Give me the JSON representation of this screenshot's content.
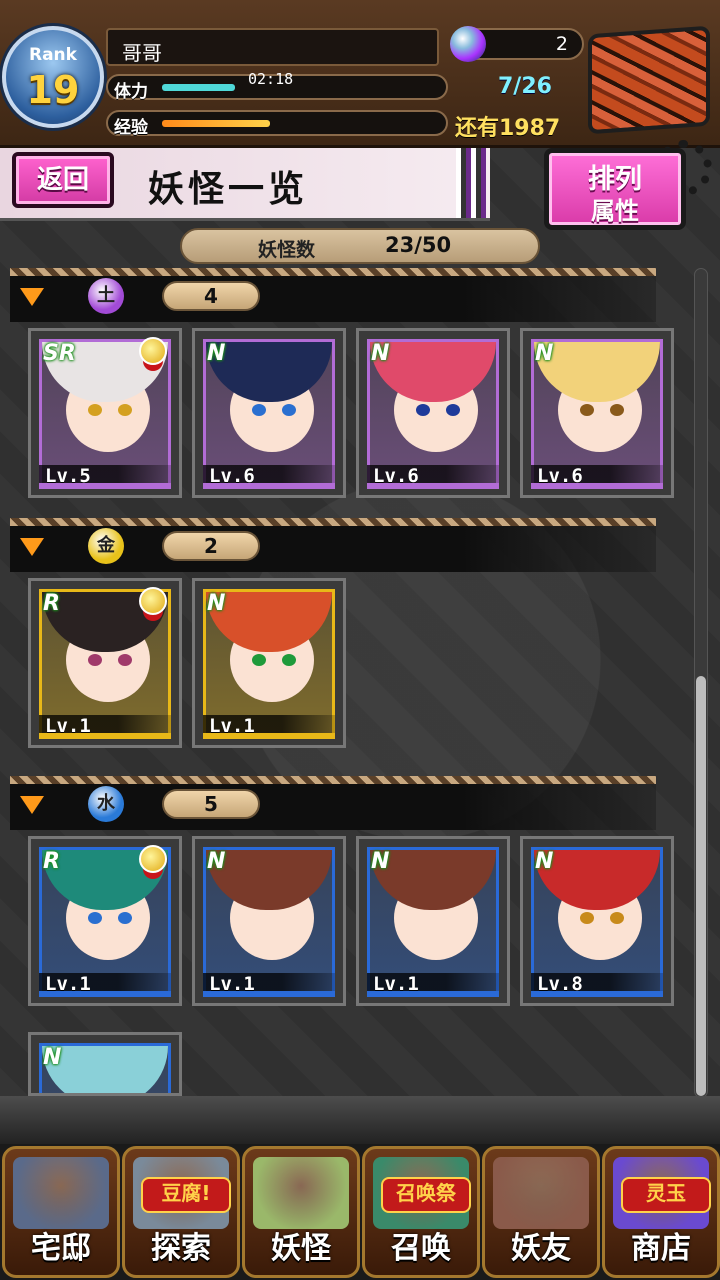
{
  "player": {
    "rank_label": "Rank",
    "rank": "19",
    "name": "哥哥",
    "stamina_label": "体力",
    "stamina_timer": "02:18",
    "stamina_value": "7/26",
    "stamina_fraction": 0.27,
    "exp_label": "经验",
    "exp_fraction": 0.4,
    "exp_remaining": "还有1987",
    "gems": "2"
  },
  "page": {
    "back_label": "返回",
    "title": "妖怪一览",
    "sort_line1": "排列",
    "sort_line2": "属性",
    "count_label": "妖怪数",
    "count_value": "23/50"
  },
  "groups": [
    {
      "attribute_icon": "dark-attribute-icon",
      "attribute_glyph": "土",
      "attribute_color": "#a24bd6",
      "count": "4",
      "cards": [
        {
          "rarity": "SR",
          "level": "Lv.5",
          "medal": true,
          "hair": "#e8e4e4",
          "eye": "#d4a020",
          "frame": "#b26cd6"
        },
        {
          "rarity": "N",
          "level": "Lv.6",
          "medal": false,
          "hair": "#1e2a56",
          "eye": "#2a6fd0",
          "frame": "#b26cd6"
        },
        {
          "rarity": "N",
          "level": "Lv.6",
          "medal": false,
          "hair": "#e04a6a",
          "eye": "#1e3a9a",
          "frame": "#b26cd6"
        },
        {
          "rarity": "N",
          "level": "Lv.6",
          "medal": false,
          "hair": "#f2d27a",
          "eye": "#8a5a1a",
          "frame": "#b26cd6"
        }
      ]
    },
    {
      "attribute_icon": "light-attribute-icon",
      "attribute_glyph": "金",
      "attribute_color": "#e8c21a",
      "count": "2",
      "cards": [
        {
          "rarity": "R",
          "level": "Lv.1",
          "medal": true,
          "hair": "#2a2222",
          "eye": "#a03a6a",
          "frame": "#e8b818"
        },
        {
          "rarity": "N",
          "level": "Lv.1",
          "medal": false,
          "hair": "#d8502a",
          "eye": "#1e9a3a",
          "frame": "#e8b818"
        }
      ]
    },
    {
      "attribute_icon": "water-attribute-icon",
      "attribute_glyph": "水",
      "attribute_color": "#2a7ad8",
      "count": "5",
      "cards": [
        {
          "rarity": "R",
          "level": "Lv.1",
          "medal": true,
          "hair": "#1e8a7a",
          "eye": "#2a6fd0",
          "frame": "#2a6ad8"
        },
        {
          "rarity": "N",
          "level": "Lv.1",
          "medal": false,
          "hair": "#7a3a2a",
          "eye": "#fbe2d3",
          "frame": "#2a6ad8"
        },
        {
          "rarity": "N",
          "level": "Lv.1",
          "medal": false,
          "hair": "#7a3a2a",
          "eye": "#fbe2d3",
          "frame": "#2a6ad8"
        },
        {
          "rarity": "N",
          "level": "Lv.8",
          "medal": false,
          "hair": "#c82a2a",
          "eye": "#c88a1a",
          "frame": "#2a6ad8"
        },
        {
          "rarity": "N",
          "level": "",
          "medal": false,
          "hair": "#8ad0d8",
          "eye": "#fbe2d3",
          "frame": "#2a6ad8"
        }
      ]
    }
  ],
  "nav": [
    {
      "label": "宅邸",
      "icon": "house-icon",
      "color": "#5a6a8a"
    },
    {
      "label": "探索",
      "icon": "tofu-explore-icon",
      "color": "#7a8a9a",
      "badge": "豆腐!"
    },
    {
      "label": "妖怪",
      "icon": "scroll-icon",
      "color": "#9ab86a"
    },
    {
      "label": "召唤",
      "icon": "summon-star-icon",
      "color": "#3a8a6a",
      "badge": "召唤祭"
    },
    {
      "label": "妖友",
      "icon": "friend-catgirl-icon",
      "color": "#8a5a4a"
    },
    {
      "label": "商店",
      "icon": "spirit-orb-icon",
      "color": "#6a4ad0",
      "badge": "灵玉"
    }
  ]
}
